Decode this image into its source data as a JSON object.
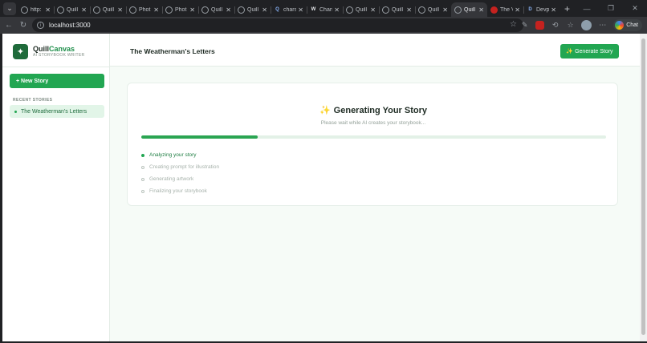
{
  "browser": {
    "tabs": [
      {
        "title": "http:",
        "icon": "globe-icon",
        "active": false
      },
      {
        "title": "Quill",
        "icon": "globe-icon",
        "active": false
      },
      {
        "title": "Quill",
        "icon": "globe-icon",
        "active": false
      },
      {
        "title": "Phot",
        "icon": "globe-icon",
        "active": false
      },
      {
        "title": "Phot",
        "icon": "globe-icon",
        "active": false
      },
      {
        "title": "Quill",
        "icon": "globe-icon",
        "active": false
      },
      {
        "title": "Quill",
        "icon": "globe-icon",
        "active": false
      },
      {
        "title": "chars",
        "icon": "search-icon",
        "active": false
      },
      {
        "title": "Chars",
        "icon": "wikipedia-icon",
        "active": false
      },
      {
        "title": "Quill",
        "icon": "globe-icon",
        "active": false
      },
      {
        "title": "Quill",
        "icon": "globe-icon",
        "active": false
      },
      {
        "title": "Quill",
        "icon": "globe-icon",
        "active": false
      },
      {
        "title": "Quill",
        "icon": "globe-icon",
        "active": true
      },
      {
        "title": "The V",
        "icon": "red-site-icon",
        "active": false
      },
      {
        "title": "Devp",
        "icon": "d-icon",
        "active": false
      }
    ],
    "url": "localhost:3000",
    "chat_label": "Chat"
  },
  "sidebar": {
    "brand_name_1": "Quill",
    "brand_name_2": "Canvas",
    "brand_tagline": "AI STORYBOOK WRITER",
    "new_story_label": "+ New Story",
    "recent_heading": "RECENT STORIES",
    "recent_items": [
      {
        "label": "The Weatherman's Letters"
      }
    ]
  },
  "header": {
    "title": "The Weatherman's Letters",
    "generate_label": "✨ Generate Story"
  },
  "generating": {
    "title": "Generating Your Story",
    "subtitle": "Please wait while AI creates your storybook...",
    "progress_percent": 25,
    "steps": [
      {
        "label": "Analyzing your story",
        "status": "active"
      },
      {
        "label": "Creating prompt for illustration",
        "status": "pending"
      },
      {
        "label": "Generating artwork",
        "status": "pending"
      },
      {
        "label": "Finalizing your storybook",
        "status": "pending"
      }
    ]
  },
  "colors": {
    "brand_green": "#22a652",
    "logo_green": "#1f6b3b",
    "background": "#f6fbf7"
  }
}
